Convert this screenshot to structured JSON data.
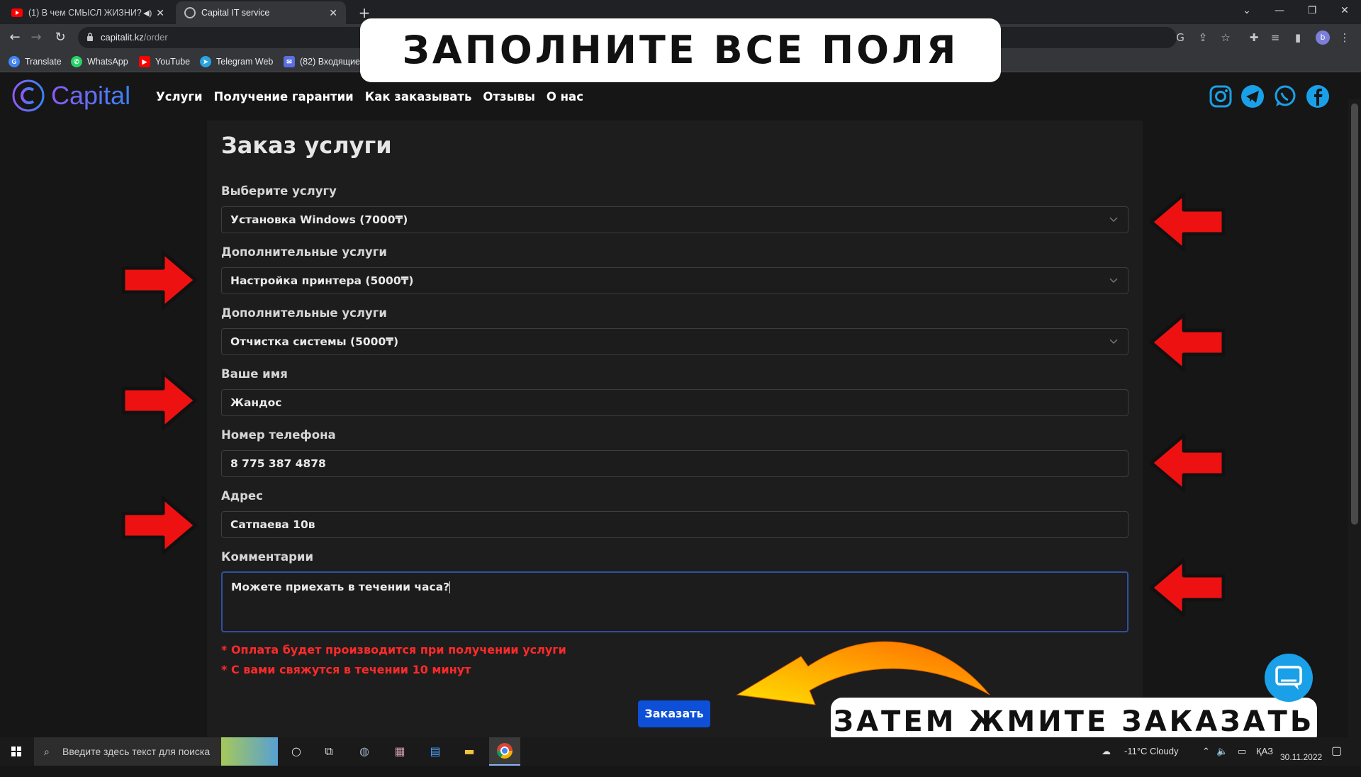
{
  "browser": {
    "tabs": [
      {
        "title": "(1) В чем СМЫСЛ ЖИЗНИ?",
        "icon": "youtube-icon",
        "active": false
      },
      {
        "title": "Capital IT service",
        "icon": "site-icon",
        "active": true
      }
    ],
    "url_host": "capitalit.kz",
    "url_path": "/order",
    "profile_initial": "b",
    "bookmarks": [
      {
        "label": "Translate",
        "icon": "google-icon"
      },
      {
        "label": "WhatsApp",
        "icon": "whatsapp-icon"
      },
      {
        "label": "YouTube",
        "icon": "youtube-icon"
      },
      {
        "label": "Telegram Web",
        "icon": "telegram-icon"
      },
      {
        "label": "(82) Входящие",
        "icon": "mail-icon"
      }
    ]
  },
  "site": {
    "logo": "Capital",
    "nav": [
      "Услуги",
      "Получение гарантии",
      "Как заказывать",
      "Отзывы",
      "О нас"
    ],
    "social": [
      "instagram-icon",
      "telegram-icon",
      "whatsapp-icon",
      "facebook-icon"
    ]
  },
  "form": {
    "title": "Заказ услуги",
    "service": {
      "label": "Выберите услугу",
      "value": "Установка Windows (7000₸)"
    },
    "extra1": {
      "label": "Дополнительные услуги",
      "value": "Настройка принтера (5000₸)"
    },
    "extra2": {
      "label": "Дополнительные услуги",
      "value": "Отчистка системы (5000₸)"
    },
    "name": {
      "label": "Ваше имя",
      "value": "Жандос"
    },
    "phone": {
      "label": "Номер телефона",
      "value": "8 775 387 4878"
    },
    "address": {
      "label": "Адрес",
      "value": "Сатпаева 10в"
    },
    "comment": {
      "label": "Комментарии",
      "value": "Можете приехать в течении часа?"
    },
    "notes": [
      "* Оплата будет производится при получении услуги",
      "* С вами свяжутся в течении 10 минут"
    ],
    "submit": "Заказать"
  },
  "overlay": {
    "top": "ЗАПОЛНИТЕ  ВСЕ  ПОЛЯ",
    "bottom": "ЗАТЕМ  ЖМИТЕ  ЗАКАЗАТЬ"
  },
  "taskbar": {
    "search_placeholder": "Введите здесь текст для поиска",
    "weather": "-11°C  Cloudy",
    "lang": "ҚАЗ",
    "date": "30.11.2022"
  },
  "colors": {
    "accent": "#0d4fd6",
    "note": "#ff2a2a",
    "arrow": "#ee1111"
  }
}
